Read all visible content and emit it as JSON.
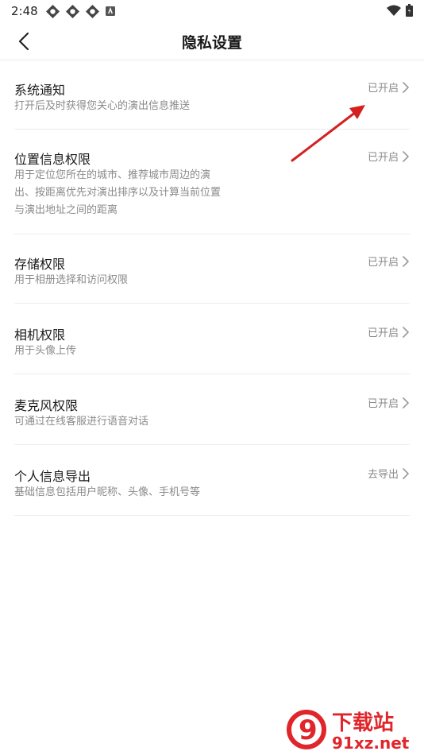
{
  "status_bar": {
    "time": "2:48",
    "icons": [
      "app-icon",
      "app-icon",
      "app-icon",
      "notification-icon"
    ],
    "right_icons": [
      "wifi-icon",
      "battery-icon"
    ]
  },
  "header": {
    "back_icon": "chevron-left-icon",
    "title": "隐私设置"
  },
  "settings": [
    {
      "title": "系统通知",
      "desc_lines": [
        "打开后及时获得您关心的演出信息推送"
      ],
      "status": "已开启"
    },
    {
      "title": "位置信息权限",
      "desc_lines": [
        "用于定位您所在的城市、推荐城市周边的演",
        "出、按距离优先对演出排序以及计算当前位置",
        "与演出地址之间的距离"
      ],
      "status": "已开启"
    },
    {
      "title": "存储权限",
      "desc_lines": [
        "用于相册选择和访问权限"
      ],
      "status": "已开启"
    },
    {
      "title": "相机权限",
      "desc_lines": [
        "用于头像上传"
      ],
      "status": "已开启"
    },
    {
      "title": "麦克风权限",
      "desc_lines": [
        "可通过在线客服进行语音对话"
      ],
      "status": "已开启"
    },
    {
      "title": "个人信息导出",
      "desc_lines": [
        "基础信息包括用户昵称、头像、手机号等"
      ],
      "status": "去导出"
    }
  ],
  "watermark": {
    "logo_text": "9",
    "site_name": "下载站",
    "url": "91xz.net"
  },
  "colors": {
    "annotation_arrow": "#d42020",
    "watermark": "#e0252b",
    "divider": "#ececec"
  }
}
